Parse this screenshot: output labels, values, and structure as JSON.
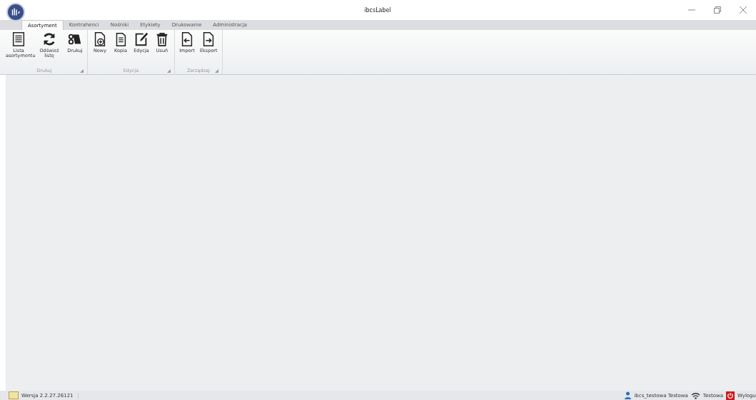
{
  "window": {
    "title": "ibcsLabel"
  },
  "tabs": [
    {
      "label": "Asortyment",
      "selected": true
    },
    {
      "label": "Kontrahenci",
      "selected": false
    },
    {
      "label": "Nośniki",
      "selected": false
    },
    {
      "label": "Etykiety",
      "selected": false
    },
    {
      "label": "Drukowanie",
      "selected": false
    },
    {
      "label": "Administracja",
      "selected": false
    }
  ],
  "ribbon_groups": [
    {
      "label": "Drukuj",
      "buttons": [
        {
          "kind": "list",
          "label": "Lista asortymentu"
        },
        {
          "kind": "refresh",
          "label": "Odśwież listę"
        },
        {
          "kind": "print",
          "label": "Drukuj"
        }
      ]
    },
    {
      "label": "Edycja",
      "buttons": [
        {
          "kind": "new",
          "label": "Nowy"
        },
        {
          "kind": "copy",
          "label": "Kopia"
        },
        {
          "kind": "edit",
          "label": "Edycja"
        },
        {
          "kind": "delete",
          "label": "Usuń"
        }
      ]
    },
    {
      "label": "Zarządzaj",
      "buttons": [
        {
          "kind": "import",
          "label": "Import"
        },
        {
          "kind": "export",
          "label": "Eksport"
        }
      ]
    }
  ],
  "status_bar": {
    "version": "Wersja 2.2.27.26121",
    "user": "ibcs_testowa Testowa",
    "environment": "Testowa",
    "logout": "Wylogu"
  }
}
